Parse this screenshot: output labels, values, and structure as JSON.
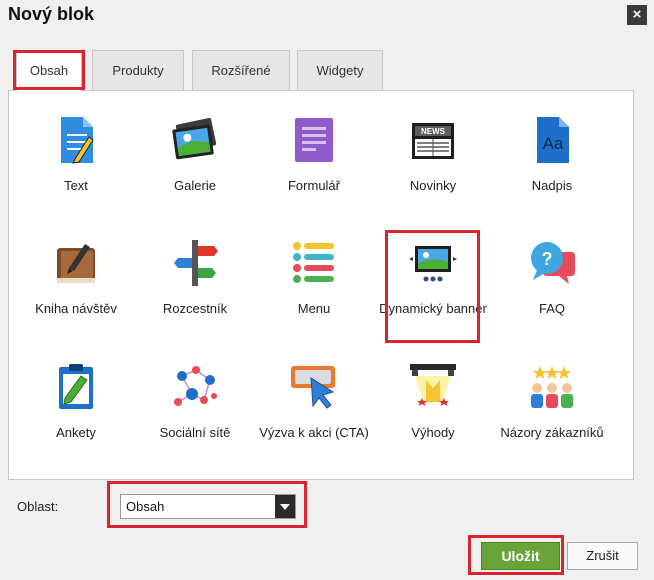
{
  "dialog": {
    "title": "Nový blok",
    "close": "×"
  },
  "tabs": [
    {
      "label": "Obsah"
    },
    {
      "label": "Produkty"
    },
    {
      "label": "Rozšířené"
    },
    {
      "label": "Widgety"
    }
  ],
  "blocks": [
    {
      "label": "Text",
      "icon": "text-document-icon"
    },
    {
      "label": "Galerie",
      "icon": "gallery-icon"
    },
    {
      "label": "Formulář",
      "icon": "form-icon"
    },
    {
      "label": "Novinky",
      "icon": "newspaper-icon",
      "icon_text": "NEWS"
    },
    {
      "label": "Nadpis",
      "icon": "heading-icon",
      "icon_text": "Aa"
    },
    {
      "label": "Kniha návštěv",
      "icon": "guestbook-icon"
    },
    {
      "label": "Rozcestník",
      "icon": "signpost-icon"
    },
    {
      "label": "Menu",
      "icon": "menu-icon"
    },
    {
      "label": "Dynamický banner",
      "icon": "banner-slider-icon"
    },
    {
      "label": "FAQ",
      "icon": "faq-icon",
      "icon_text": "?"
    },
    {
      "label": "Ankety",
      "icon": "poll-icon"
    },
    {
      "label": "Sociální sítě",
      "icon": "social-network-icon"
    },
    {
      "label": "Výzva k akci (CTA)",
      "icon": "cta-icon"
    },
    {
      "label": "Výhody",
      "icon": "benefits-icon"
    },
    {
      "label": "Názory zákazníků",
      "icon": "testimonials-icon"
    }
  ],
  "area": {
    "label": "Oblast:",
    "value": "Obsah"
  },
  "buttons": {
    "save": "Uložit",
    "cancel": "Zrušit"
  },
  "colors": {
    "accent_green": "#6aa338",
    "highlight_red": "#d9232e"
  }
}
